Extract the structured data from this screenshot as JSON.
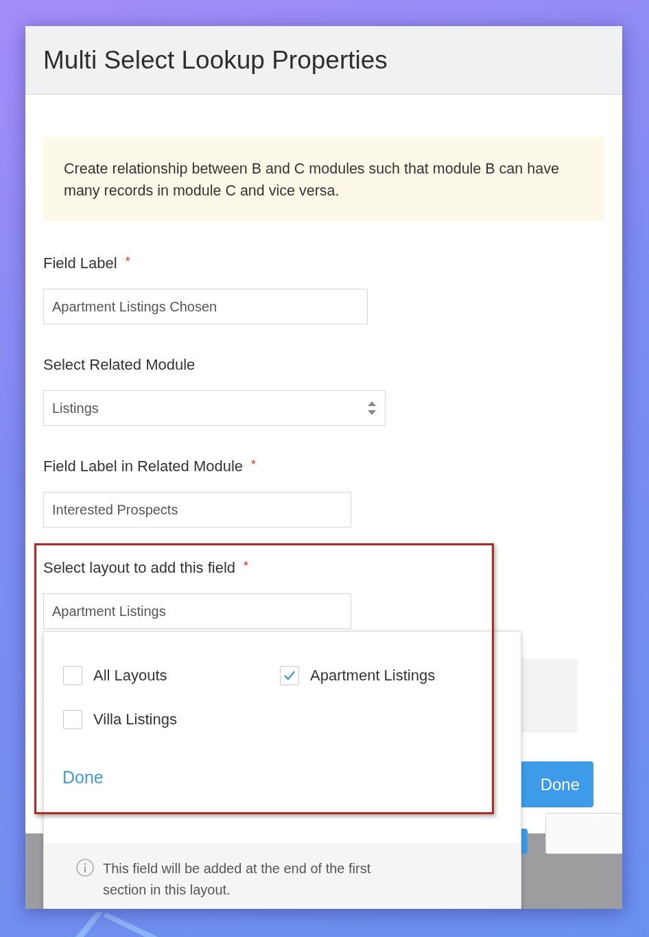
{
  "window": {
    "title": "Multi Select Lookup Properties"
  },
  "notice": "Create relationship between B and C modules such that module B can have many records in module C and vice versa.",
  "fields": [
    {
      "kind": "text",
      "label": "Field Label",
      "required_mark": "*",
      "value": "Apartment Listings Chosen"
    },
    {
      "kind": "select",
      "label": "Select Related Module",
      "value": "Listings"
    },
    {
      "kind": "text",
      "label": "Field Label in Related Module",
      "required_mark": "*",
      "value": "Interested Prospects"
    },
    {
      "kind": "text",
      "label": "Select layout to add this field",
      "required_mark": "*",
      "value": "Apartment Listings"
    }
  ],
  "layout_menu": {
    "options": [
      {
        "label": "All Layouts",
        "checked": false
      },
      {
        "label": "Apartment Listings",
        "checked": true
      },
      {
        "label": "Villa Listings",
        "checked": false
      }
    ],
    "link": "Done",
    "note": "This field will be added at the end of the first section in this layout."
  },
  "buttons": [
    {
      "kind": "primary",
      "label": "Done"
    }
  ]
}
